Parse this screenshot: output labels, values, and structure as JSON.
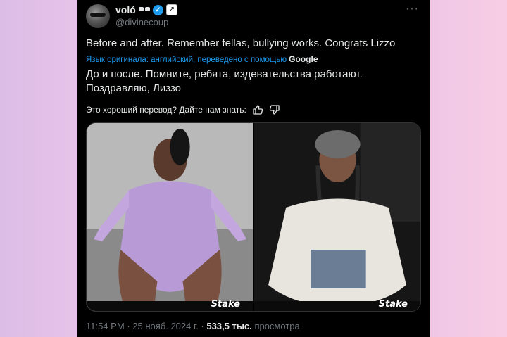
{
  "tweet": {
    "display_name": "voló",
    "handle": "@divinecoup",
    "text": "Before and after. Remember fellas, bullying works. Congrats Lizzo",
    "translation_note": "Язык оригинала: английский, переведено с помощью",
    "translation_provider": "Google",
    "translation": "До и после. Помните, ребята, издевательства работают. Поздравляю, Лиззо",
    "rating_prompt": "Это хороший перевод? Дайте нам знать:",
    "time": "11:54 PM",
    "date": "25 нояб. 2024 г.",
    "views_count": "533,5 тыс.",
    "views_label": "просмотра",
    "more_label": "···",
    "verified_glyph": "✓",
    "affiliate_glyph": "↗",
    "media": {
      "watermark": "Stake"
    }
  },
  "colors": {
    "background_left": "#dcbde6",
    "background_right": "#f7cde4",
    "card": "#000000",
    "text": "#e7e9ea",
    "muted": "#71767b",
    "link": "#1d9bf0",
    "verified": "#1d9bf0"
  }
}
